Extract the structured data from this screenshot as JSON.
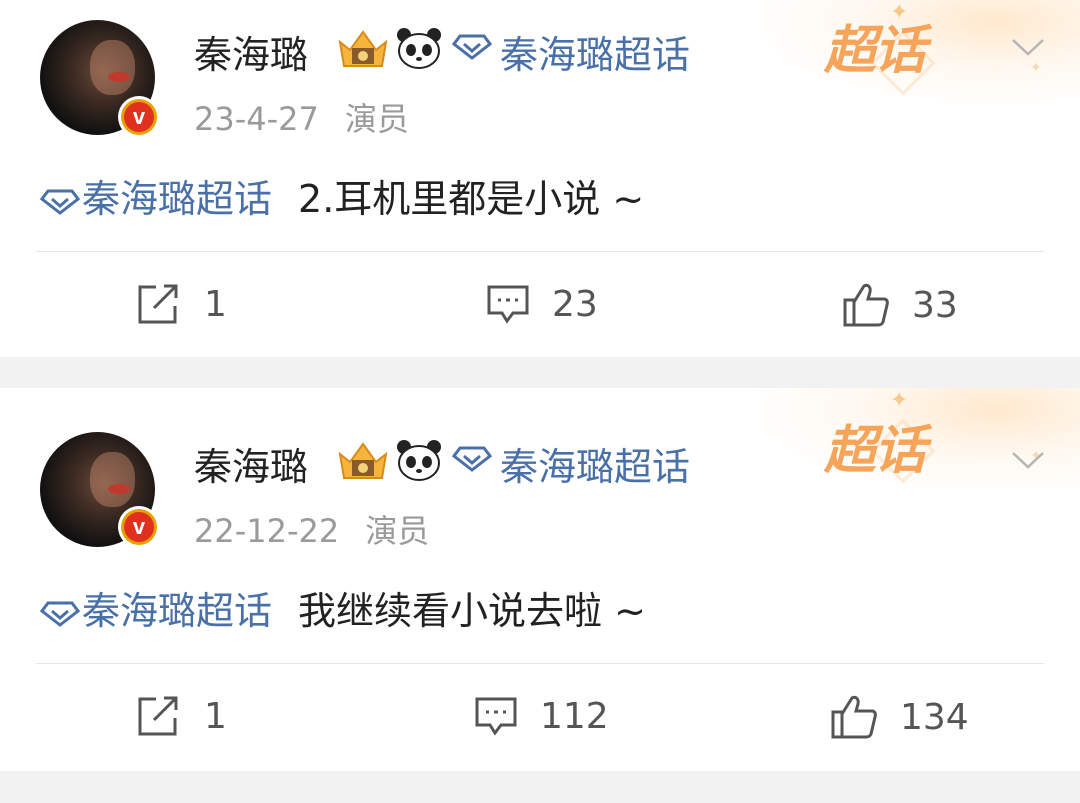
{
  "posts": [
    {
      "username": "秦海璐",
      "topic_label": "秦海璐超话",
      "date": "23-4-27",
      "role": "演员",
      "content_tag": "秦海璐超话",
      "content_text": "2.耳机里都是小说 ~",
      "repost_count": "1",
      "comment_count": "23",
      "like_count": "33",
      "badge_text": "超话"
    },
    {
      "username": "秦海璐",
      "topic_label": "秦海璐超话",
      "date": "22-12-22",
      "role": "演员",
      "content_tag": "秦海璐超话",
      "content_text": "我继续看小说去啦 ~",
      "repost_count": "1",
      "comment_count": "112",
      "like_count": "134",
      "badge_text": "超话"
    }
  ],
  "verified_mark": "v",
  "colors": {
    "link": "#4a70a8",
    "badge": "#f5a45a",
    "verified": "#e0301e"
  }
}
